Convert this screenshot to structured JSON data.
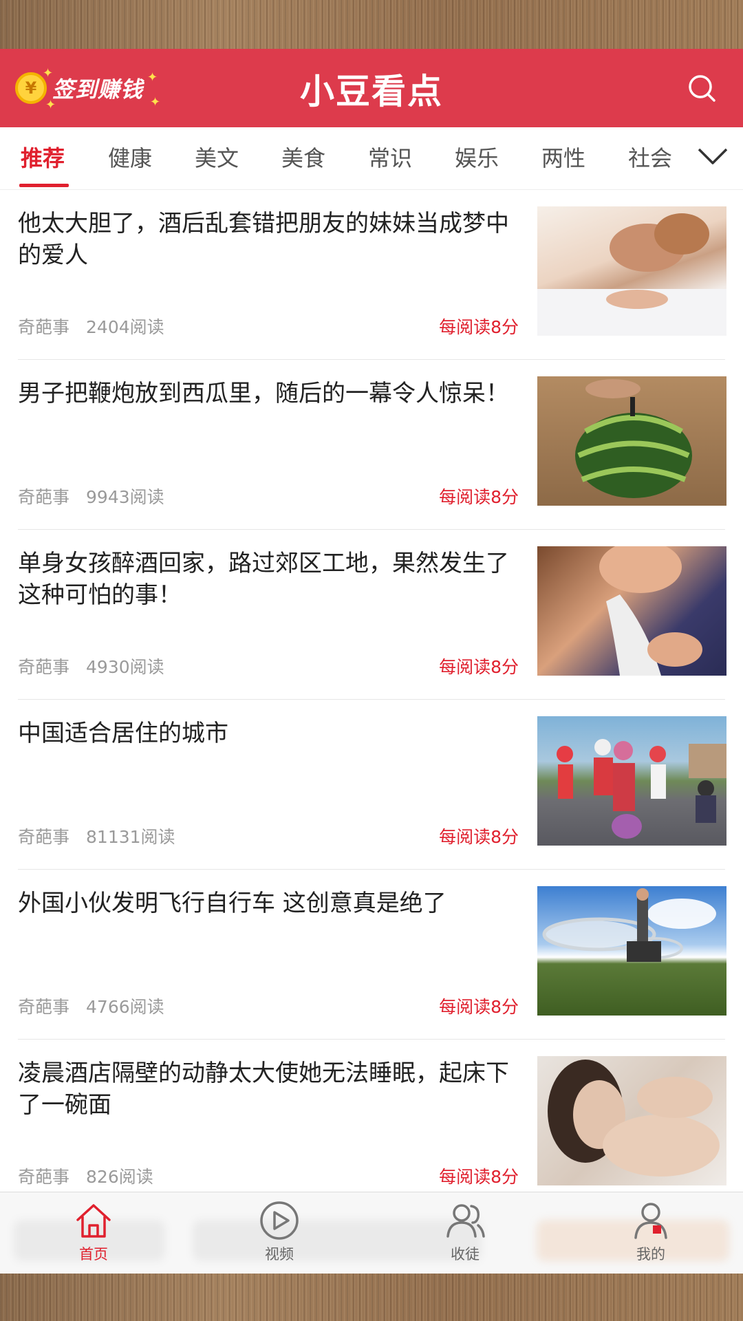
{
  "header": {
    "checkin_label": "签到赚钱",
    "coin_symbol": "¥",
    "app_title": "小豆看点",
    "search_icon": "search-icon"
  },
  "tabs": [
    {
      "label": "推荐",
      "active": true
    },
    {
      "label": "健康"
    },
    {
      "label": "美文"
    },
    {
      "label": "美食"
    },
    {
      "label": "常识"
    },
    {
      "label": "娱乐"
    },
    {
      "label": "两性"
    },
    {
      "label": "社会"
    }
  ],
  "feed": [
    {
      "title": "他太大胆了，酒后乱套错把朋友的妹妹当成梦中的爱人",
      "source": "奇葩事",
      "reads": "2404阅读",
      "reward": "每阅读8分"
    },
    {
      "title": "男子把鞭炮放到西瓜里，随后的一幕令人惊呆！",
      "source": "奇葩事",
      "reads": "9943阅读",
      "reward": "每阅读8分"
    },
    {
      "title": "单身女孩醉酒回家，路过郊区工地，果然发生了这种可怕的事！",
      "source": "奇葩事",
      "reads": "4930阅读",
      "reward": "每阅读8分"
    },
    {
      "title": "中国适合居住的城市",
      "source": "奇葩事",
      "reads": "81131阅读",
      "reward": "每阅读8分"
    },
    {
      "title": "外国小伙发明飞行自行车 这创意真是绝了",
      "source": "奇葩事",
      "reads": "4766阅读",
      "reward": "每阅读8分"
    },
    {
      "title": "凌晨酒店隔壁的动静太大使她无法睡眠，起床下了一碗面",
      "source": "奇葩事",
      "reads": "826阅读",
      "reward": "每阅读8分"
    }
  ],
  "bottom_nav": [
    {
      "label": "首页",
      "icon": "home-icon",
      "active": true
    },
    {
      "label": "视频",
      "icon": "play-icon"
    },
    {
      "label": "收徒",
      "icon": "users-icon"
    },
    {
      "label": "我的",
      "icon": "profile-icon"
    }
  ],
  "colors": {
    "brand_red": "#dd3b4c",
    "accent_red": "#e0202e"
  }
}
